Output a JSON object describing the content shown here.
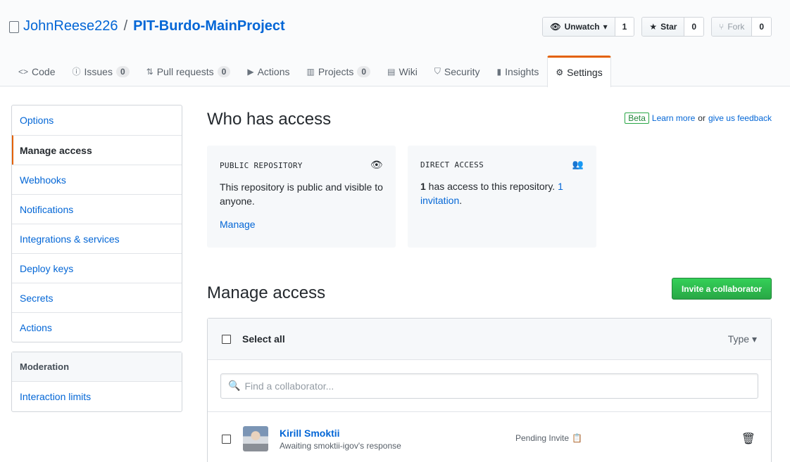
{
  "repo": {
    "owner": "JohnReese226",
    "separator": "/",
    "name": "PIT-Burdo-MainProject"
  },
  "actions": {
    "watch": {
      "label": "Unwatch",
      "count": "1"
    },
    "star": {
      "label": "Star",
      "count": "0"
    },
    "fork": {
      "label": "Fork",
      "count": "0"
    }
  },
  "nav": {
    "code": "Code",
    "issues": {
      "label": "Issues",
      "count": "0"
    },
    "pulls": {
      "label": "Pull requests",
      "count": "0"
    },
    "actions": "Actions",
    "projects": {
      "label": "Projects",
      "count": "0"
    },
    "wiki": "Wiki",
    "security": "Security",
    "insights": "Insights",
    "settings": "Settings"
  },
  "sidebar": {
    "items": [
      "Options",
      "Manage access",
      "Webhooks",
      "Notifications",
      "Integrations & services",
      "Deploy keys",
      "Secrets",
      "Actions"
    ],
    "moderation_heading": "Moderation",
    "moderation_items": [
      "Interaction limits"
    ]
  },
  "access": {
    "title": "Who has access",
    "beta": "Beta",
    "learn_more": "Learn more",
    "or": "or",
    "feedback": "give us feedback",
    "public_box": {
      "caption": "PUBLIC REPOSITORY",
      "text": "This repository is public and visible to anyone.",
      "link": "Manage"
    },
    "direct_box": {
      "caption": "DIRECT ACCESS",
      "count": "1",
      "text": " has access to this repository. ",
      "link": "1 invitation",
      "end": "."
    }
  },
  "manage": {
    "title": "Manage access",
    "invite_button": "Invite a collaborator",
    "select_all": "Select all",
    "type_filter": "Type",
    "search_placeholder": "Find a collaborator...",
    "members": [
      {
        "name": "Kirill Smoktii",
        "status": "Awaiting smoktii-igov's response",
        "role": "Pending Invite"
      }
    ]
  },
  "colors": {
    "accent": "#e36209",
    "link": "#0366d6",
    "green": "#28a745"
  }
}
